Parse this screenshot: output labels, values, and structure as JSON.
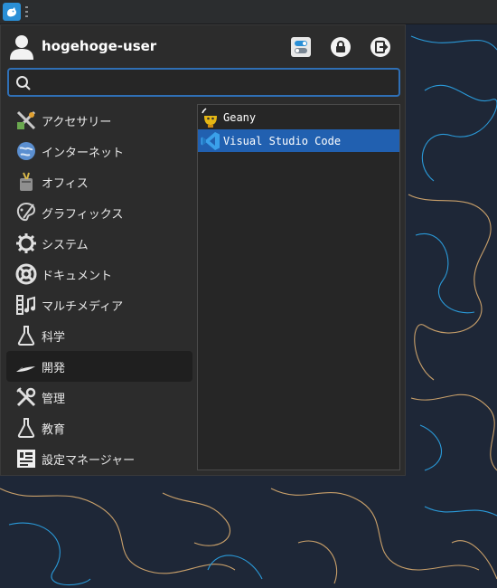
{
  "user": {
    "name": "hogehoge-user"
  },
  "header_buttons": [
    {
      "icon": "settings-toggle-icon"
    },
    {
      "icon": "lock-icon"
    },
    {
      "icon": "logout-icon"
    }
  ],
  "search": {
    "value": "",
    "placeholder": ""
  },
  "categories": [
    {
      "label": "アクセサリー",
      "icon": "accessories-icon"
    },
    {
      "label": "インターネット",
      "icon": "globe-icon"
    },
    {
      "label": "オフィス",
      "icon": "office-icon"
    },
    {
      "label": "グラフィックス",
      "icon": "graphics-icon"
    },
    {
      "label": "システム",
      "icon": "gear-icon"
    },
    {
      "label": "ドキュメント",
      "icon": "help-icon"
    },
    {
      "label": "マルチメディア",
      "icon": "multimedia-icon"
    },
    {
      "label": "科学",
      "icon": "flask-icon"
    },
    {
      "label": "開発",
      "icon": "development-icon",
      "active": true
    },
    {
      "label": "管理",
      "icon": "tools-icon"
    },
    {
      "label": "教育",
      "icon": "flask-icon"
    },
    {
      "label": "設定マネージャー",
      "icon": "settings-manager-icon"
    }
  ],
  "apps": [
    {
      "label": "Geany",
      "icon": "geany-icon"
    },
    {
      "label": "Visual Studio Code",
      "icon": "vscode-icon",
      "selected": true
    }
  ],
  "colors": {
    "selection": "#2160b0",
    "search_border": "#2f6fb5",
    "menu_bg": "#2c2c2c",
    "desktop_bg": "#1e2737"
  }
}
